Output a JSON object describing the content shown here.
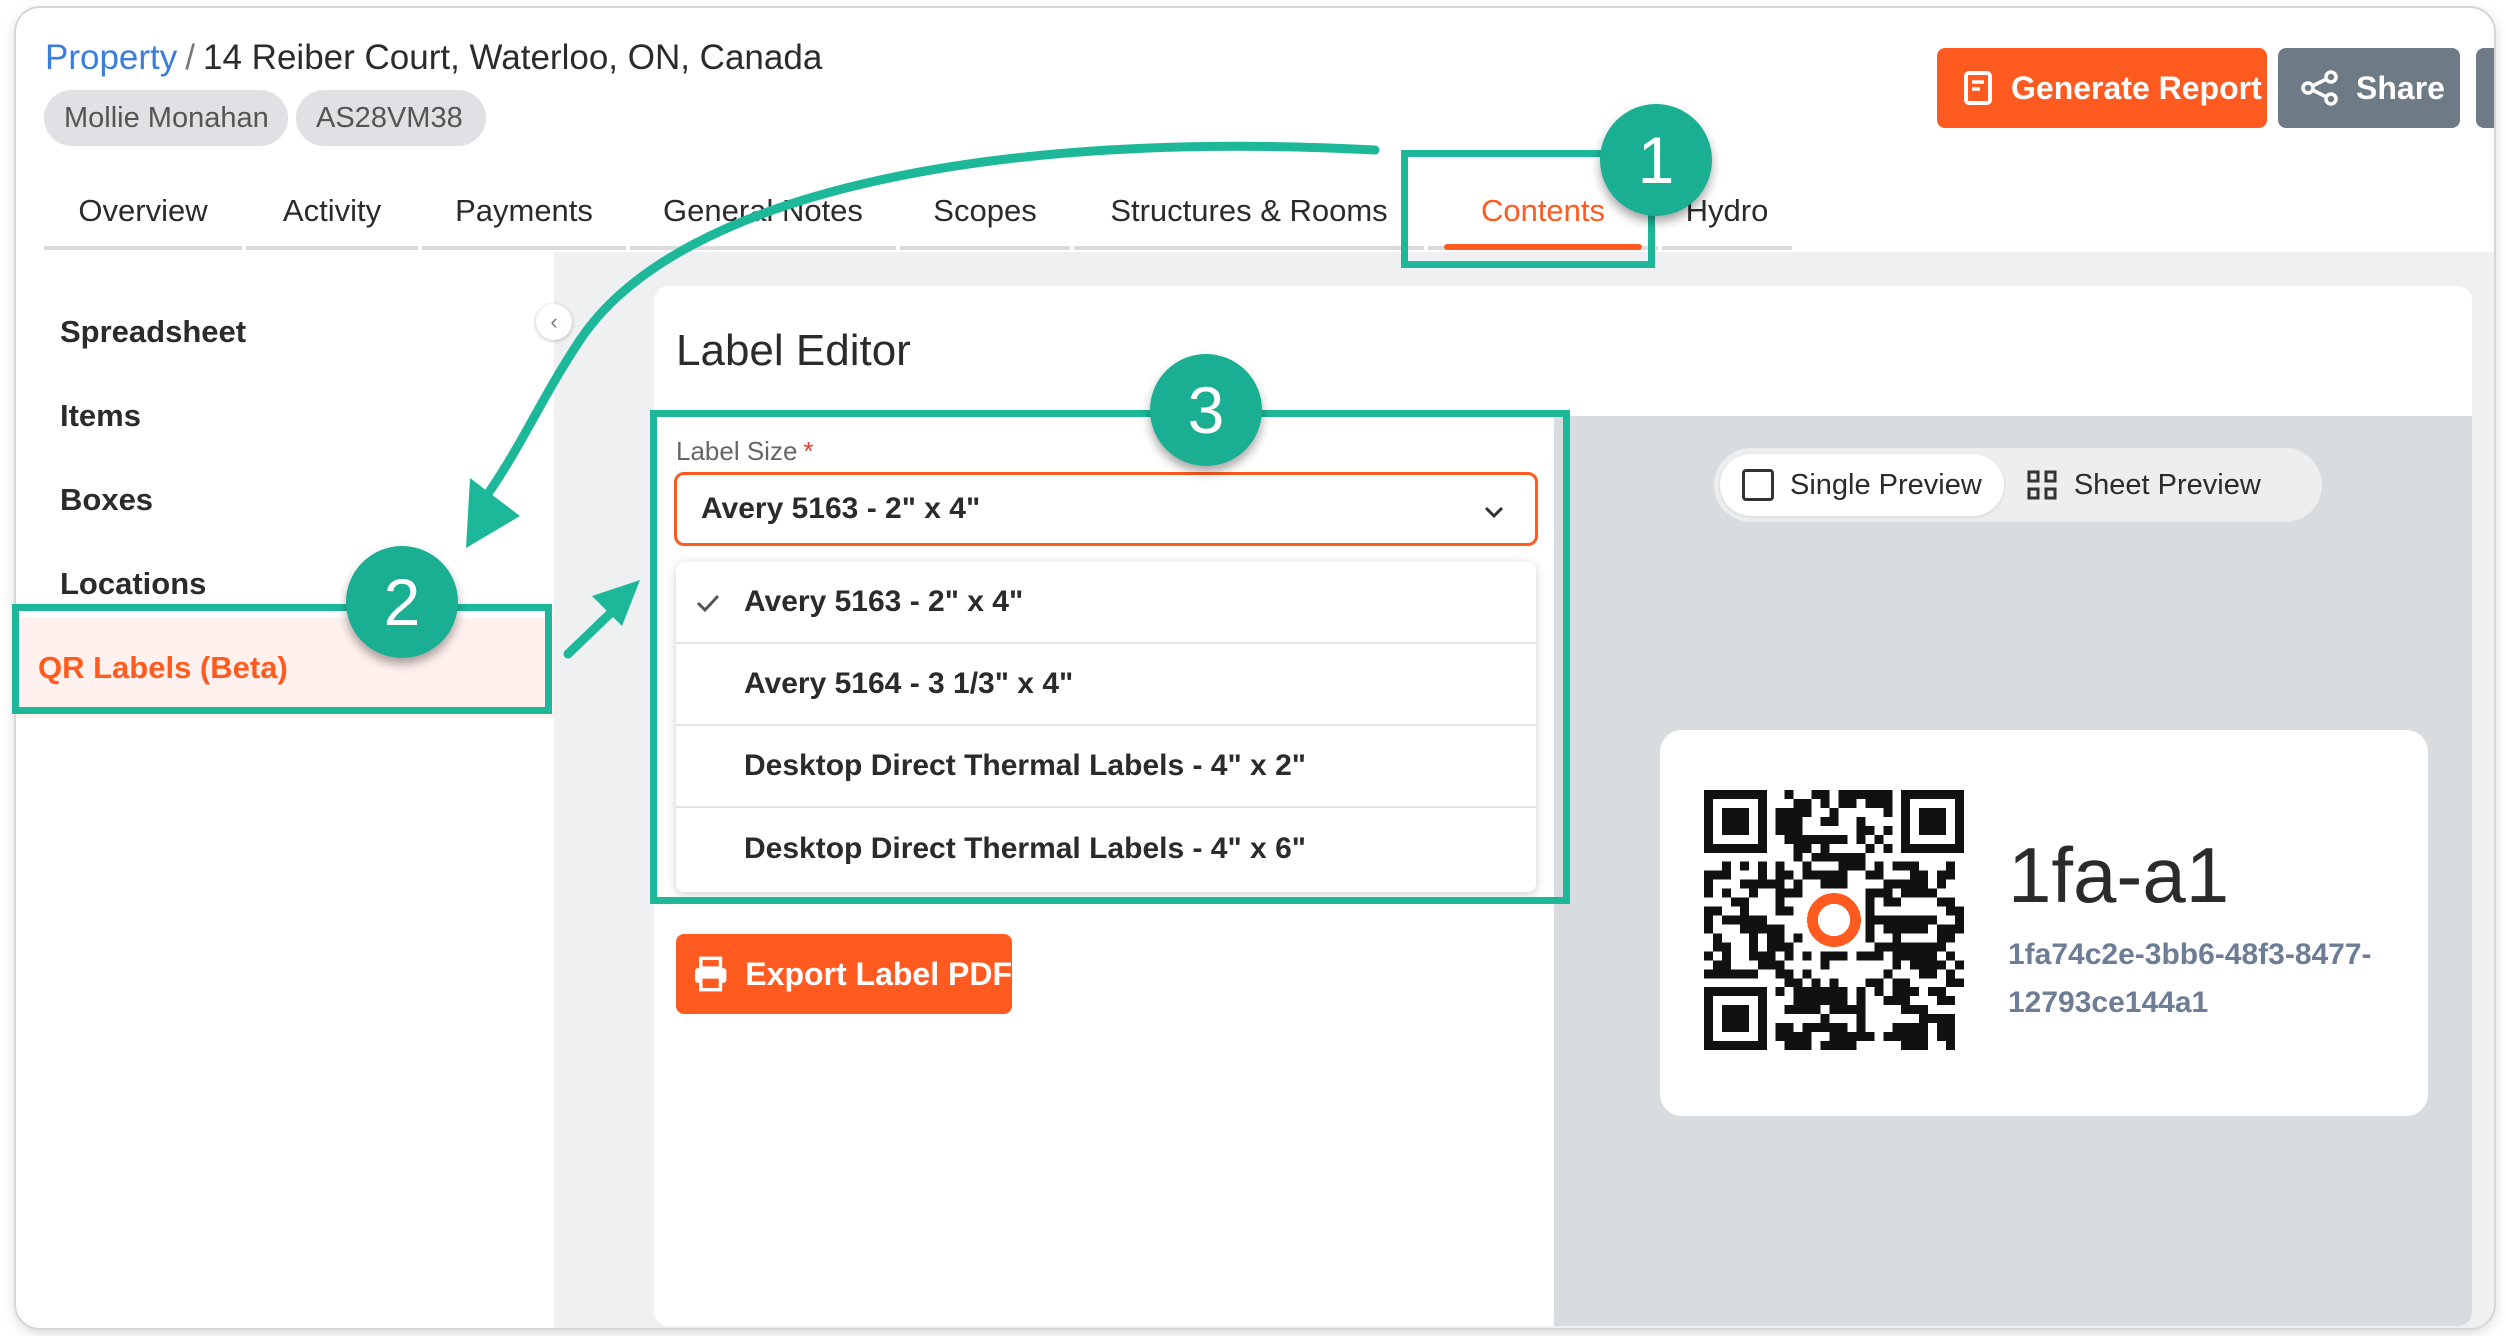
{
  "header": {
    "breadcrumb_link": "Property",
    "breadcrumb_separator": "/",
    "breadcrumb_current": "14 Reiber Court, Waterloo, ON, Canada",
    "chips": {
      "user": "Mollie Monahan",
      "id": "AS28VM38"
    },
    "generate_report_label": "Generate Report",
    "share_label": "Share"
  },
  "tabs": [
    {
      "label": "Overview"
    },
    {
      "label": "Activity"
    },
    {
      "label": "Payments"
    },
    {
      "label": "General Notes"
    },
    {
      "label": "Scopes"
    },
    {
      "label": "Structures & Rooms"
    },
    {
      "label": "Contents",
      "active": true
    },
    {
      "label": "Hydro"
    }
  ],
  "sidebar": {
    "items": [
      {
        "label": "Spreadsheet"
      },
      {
        "label": "Items"
      },
      {
        "label": "Boxes"
      },
      {
        "label": "Locations"
      },
      {
        "label": "QR Labels (Beta)",
        "active": true
      }
    ],
    "collapse_icon": "chevron-left-icon"
  },
  "editor": {
    "title": "Label Editor",
    "label_size_label": "Label Size",
    "required_mark": "*",
    "selected_size": "Avery 5163 - 2\" x 4\"",
    "options": [
      {
        "label": "Avery 5163 - 2\" x 4\"",
        "selected": true
      },
      {
        "label": "Avery 5164 - 3 1/3\" x 4\""
      },
      {
        "label": "Desktop Direct Thermal Labels - 4\" x 2\""
      },
      {
        "label": "Desktop Direct Thermal Labels - 4\" x 6\""
      }
    ],
    "export_label": "Export Label PDF"
  },
  "preview": {
    "single_label": "Single Preview",
    "sheet_label": "Sheet Preview",
    "selected_mode": "Single Preview",
    "label_name": "1fa-a1",
    "label_uuid_line1": "1fa74c2e-3bb6-48f3-8477-",
    "label_uuid_line2": "12793ce144a1"
  },
  "annotations": {
    "step1": "1",
    "step2": "2",
    "step3": "3",
    "color": "#1db89a"
  },
  "colors": {
    "accent": "#ff5a1f",
    "link": "#3b7ddd",
    "share_button": "#6e7a86",
    "annotation": "#1db89a"
  }
}
